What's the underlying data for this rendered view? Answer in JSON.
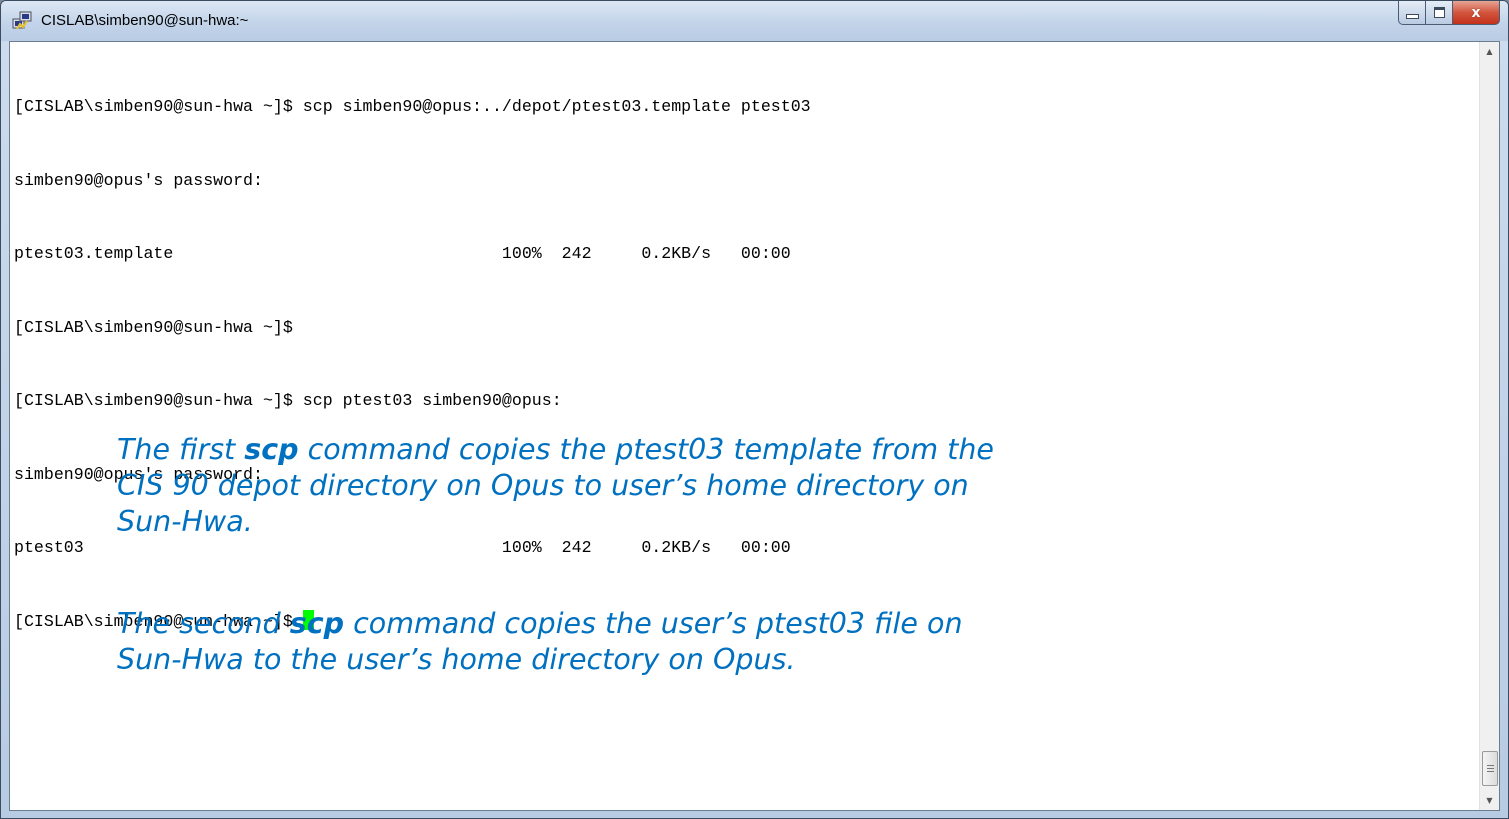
{
  "window": {
    "title": "CISLAB\\simben90@sun-hwa:~"
  },
  "caption_buttons": {
    "minimize_icon": "minimize-icon",
    "maximize_icon": "maximize-icon",
    "close_glyph": "x"
  },
  "terminal": {
    "lines": [
      "[CISLAB\\simben90@sun-hwa ~]$ scp simben90@opus:../depot/ptest03.template ptest03",
      "simben90@opus's password:",
      "ptest03.template                                 100%  242     0.2KB/s   00:00",
      "[CISLAB\\simben90@sun-hwa ~]$",
      "[CISLAB\\simben90@sun-hwa ~]$ scp ptest03 simben90@opus:",
      "simben90@opus's password:",
      "ptest03                                          100%  242     0.2KB/s   00:00",
      "[CISLAB\\simben90@sun-hwa ~]$ "
    ],
    "cursor_color": "#00ff00"
  },
  "annotations": {
    "first": {
      "before": "The first ",
      "bold": "scp",
      "after": " command copies the ptest03 template from the\nCIS 90 depot directory on Opus to user’s home directory on\nSun-Hwa."
    },
    "second": {
      "before": "The second ",
      "bold": "scp",
      "after": " command copies the user’s ptest03 file on\nSun-Hwa to the user’s home directory on Opus."
    },
    "color": "#0070c0"
  }
}
